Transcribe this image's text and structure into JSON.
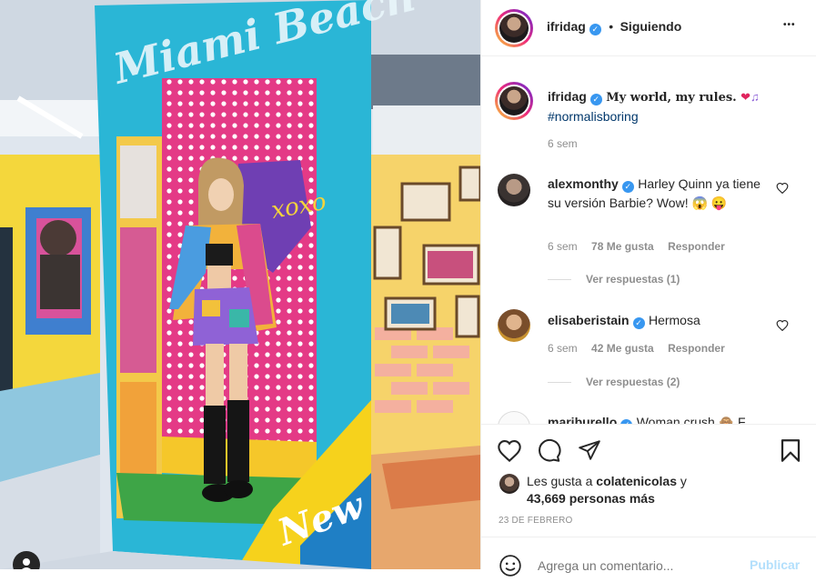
{
  "post": {
    "author": "ifridag",
    "follow_status": "Siguiendo",
    "dot": "•",
    "more": "•••"
  },
  "caption": {
    "username": "ifridag",
    "text": "My world, my rules.",
    "hashtag": "#normalisboring",
    "time": "6 sem"
  },
  "comments": [
    {
      "username": "alexmonthy",
      "text": "Harley Quinn ya tiene su versión Barbie? Wow! 😱 😛",
      "time": "6 sem",
      "likes": "78 Me gusta",
      "reply": "Responder",
      "view_replies": "Ver respuestas (1)"
    },
    {
      "username": "elisaberistain",
      "text": "Hermosa",
      "time": "6 sem",
      "likes": "42 Me gusta",
      "reply": "Responder",
      "view_replies": "Ver respuestas (2)"
    },
    {
      "username": "mariburello",
      "text": "Woman crush 🙈 F"
    }
  ],
  "likes": {
    "prefix": "Les gusta a",
    "user": "colatenicolas",
    "suffix": "y",
    "others": "43,669 personas más"
  },
  "date": "23 DE FEBRERO",
  "add_comment": {
    "placeholder": "Agrega un comentario...",
    "publish": "Publicar"
  },
  "photo": {
    "booth_top_text": "Miami Beach",
    "booth_bottom_text": "New"
  },
  "colors": {
    "verified": "#3897f0",
    "publish_disabled": "#b2dffc",
    "booth_blue": "#29b6d8",
    "booth_pink": "#e8337f",
    "booth_yellow": "#f6d21c"
  },
  "icons": [
    "heart-icon",
    "comment-icon",
    "share-icon",
    "bookmark-icon",
    "emoji-icon",
    "more-icon",
    "verified-icon"
  ]
}
